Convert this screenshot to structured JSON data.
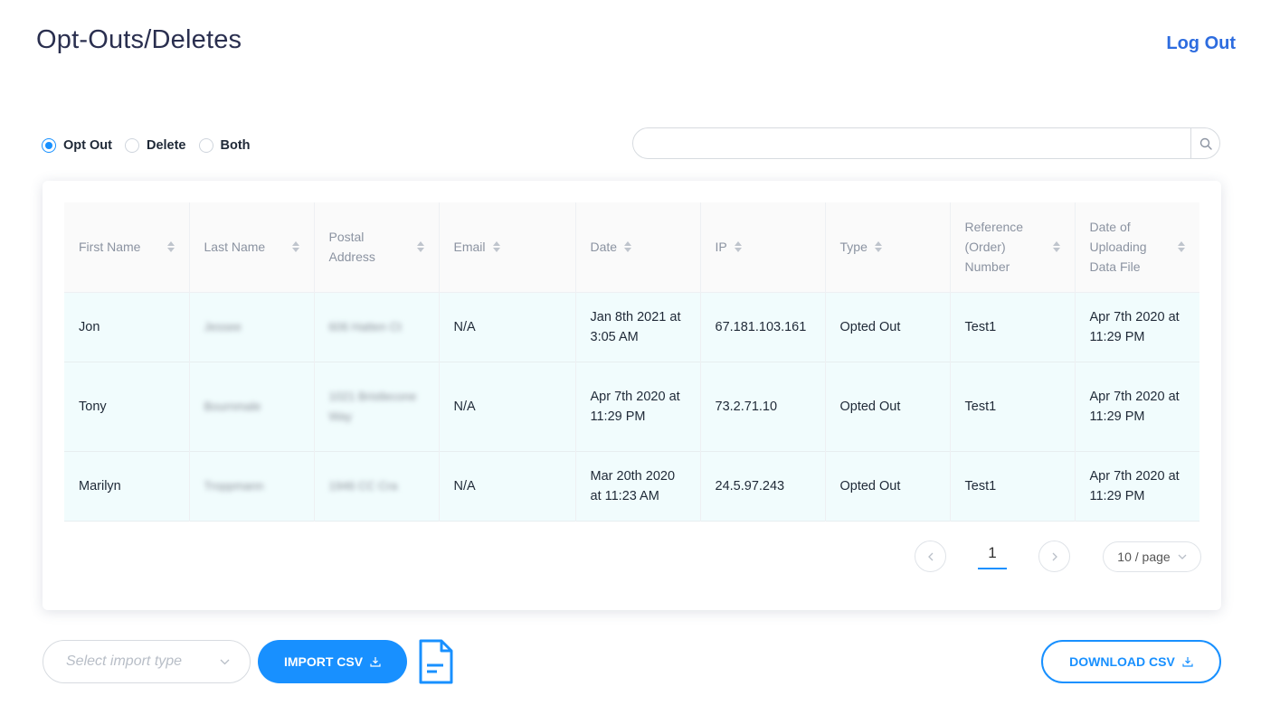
{
  "header": {
    "title": "Opt-Outs/Deletes",
    "logout_label": "Log Out"
  },
  "filters": {
    "options": [
      {
        "label": "Opt Out",
        "checked": true
      },
      {
        "label": "Delete",
        "checked": false
      },
      {
        "label": "Both",
        "checked": false
      }
    ]
  },
  "search": {
    "value": "",
    "placeholder": "",
    "icon": "search-icon"
  },
  "table": {
    "columns": [
      {
        "key": "first_name",
        "label": "First Name"
      },
      {
        "key": "last_name",
        "label": "Last Name"
      },
      {
        "key": "postal_address",
        "label": "Postal Address"
      },
      {
        "key": "email",
        "label": "Email"
      },
      {
        "key": "date",
        "label": "Date"
      },
      {
        "key": "ip",
        "label": "IP"
      },
      {
        "key": "type",
        "label": "Type"
      },
      {
        "key": "reference",
        "label": "Reference (Order) Number"
      },
      {
        "key": "upload_date",
        "label": "Date of Uploading Data File"
      }
    ],
    "rows": [
      {
        "first_name": "Jon",
        "last_name": "Jessee",
        "postal_address": "606 Hatten Ct",
        "email": "N/A",
        "date": "Jan 8th 2021 at 3:05 AM",
        "ip": "67.181.103.161",
        "type": "Opted Out",
        "reference": "Test1",
        "upload_date": "Apr 7th 2020 at 11:29 PM"
      },
      {
        "first_name": "Tony",
        "last_name": "Bournmale",
        "postal_address": "1021 Bristlecone Way",
        "email": "N/A",
        "date": "Apr 7th 2020 at 11:29 PM",
        "ip": "73.2.71.10",
        "type": "Opted Out",
        "reference": "Test1",
        "upload_date": "Apr 7th 2020 at 11:29 PM"
      },
      {
        "first_name": "Marilyn",
        "last_name": "Troppmann",
        "postal_address": "1946 CC Cra",
        "email": "N/A",
        "date": "Mar 20th 2020 at 11:23 AM",
        "ip": "24.5.97.243",
        "type": "Opted Out",
        "reference": "Test1",
        "upload_date": "Apr 7th 2020 at 11:29 PM"
      }
    ]
  },
  "pagination": {
    "current_page": "1",
    "page_size_label": "10 / page",
    "prev_icon": "chevron-left-icon",
    "next_icon": "chevron-right-icon"
  },
  "footer": {
    "import_select_placeholder": "Select import type",
    "import_label": "IMPORT CSV",
    "download_label": "DOWNLOAD CSV",
    "file_icon": "file-document-icon"
  },
  "colors": {
    "accent": "#1890ff",
    "logout": "#2d6cdf",
    "row_bg": "#f1fcfd",
    "title": "#2a2f4f"
  }
}
